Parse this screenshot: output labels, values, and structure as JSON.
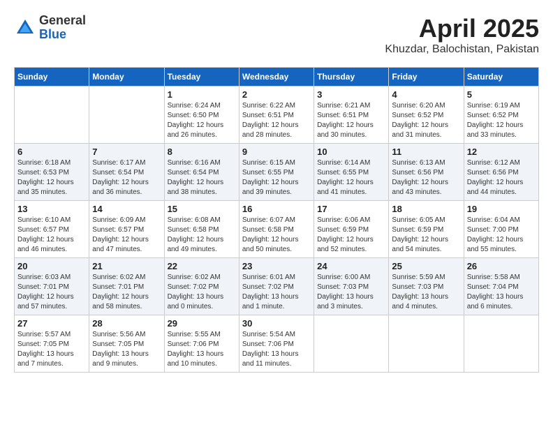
{
  "logo": {
    "general": "General",
    "blue": "Blue"
  },
  "title": "April 2025",
  "location": "Khuzdar, Balochistan, Pakistan",
  "days_of_week": [
    "Sunday",
    "Monday",
    "Tuesday",
    "Wednesday",
    "Thursday",
    "Friday",
    "Saturday"
  ],
  "weeks": [
    [
      {
        "day": "",
        "sunrise": "",
        "sunset": "",
        "daylight": ""
      },
      {
        "day": "",
        "sunrise": "",
        "sunset": "",
        "daylight": ""
      },
      {
        "day": "1",
        "sunrise": "Sunrise: 6:24 AM",
        "sunset": "Sunset: 6:50 PM",
        "daylight": "Daylight: 12 hours and 26 minutes."
      },
      {
        "day": "2",
        "sunrise": "Sunrise: 6:22 AM",
        "sunset": "Sunset: 6:51 PM",
        "daylight": "Daylight: 12 hours and 28 minutes."
      },
      {
        "day": "3",
        "sunrise": "Sunrise: 6:21 AM",
        "sunset": "Sunset: 6:51 PM",
        "daylight": "Daylight: 12 hours and 30 minutes."
      },
      {
        "day": "4",
        "sunrise": "Sunrise: 6:20 AM",
        "sunset": "Sunset: 6:52 PM",
        "daylight": "Daylight: 12 hours and 31 minutes."
      },
      {
        "day": "5",
        "sunrise": "Sunrise: 6:19 AM",
        "sunset": "Sunset: 6:52 PM",
        "daylight": "Daylight: 12 hours and 33 minutes."
      }
    ],
    [
      {
        "day": "6",
        "sunrise": "Sunrise: 6:18 AM",
        "sunset": "Sunset: 6:53 PM",
        "daylight": "Daylight: 12 hours and 35 minutes."
      },
      {
        "day": "7",
        "sunrise": "Sunrise: 6:17 AM",
        "sunset": "Sunset: 6:54 PM",
        "daylight": "Daylight: 12 hours and 36 minutes."
      },
      {
        "day": "8",
        "sunrise": "Sunrise: 6:16 AM",
        "sunset": "Sunset: 6:54 PM",
        "daylight": "Daylight: 12 hours and 38 minutes."
      },
      {
        "day": "9",
        "sunrise": "Sunrise: 6:15 AM",
        "sunset": "Sunset: 6:55 PM",
        "daylight": "Daylight: 12 hours and 39 minutes."
      },
      {
        "day": "10",
        "sunrise": "Sunrise: 6:14 AM",
        "sunset": "Sunset: 6:55 PM",
        "daylight": "Daylight: 12 hours and 41 minutes."
      },
      {
        "day": "11",
        "sunrise": "Sunrise: 6:13 AM",
        "sunset": "Sunset: 6:56 PM",
        "daylight": "Daylight: 12 hours and 43 minutes."
      },
      {
        "day": "12",
        "sunrise": "Sunrise: 6:12 AM",
        "sunset": "Sunset: 6:56 PM",
        "daylight": "Daylight: 12 hours and 44 minutes."
      }
    ],
    [
      {
        "day": "13",
        "sunrise": "Sunrise: 6:10 AM",
        "sunset": "Sunset: 6:57 PM",
        "daylight": "Daylight: 12 hours and 46 minutes."
      },
      {
        "day": "14",
        "sunrise": "Sunrise: 6:09 AM",
        "sunset": "Sunset: 6:57 PM",
        "daylight": "Daylight: 12 hours and 47 minutes."
      },
      {
        "day": "15",
        "sunrise": "Sunrise: 6:08 AM",
        "sunset": "Sunset: 6:58 PM",
        "daylight": "Daylight: 12 hours and 49 minutes."
      },
      {
        "day": "16",
        "sunrise": "Sunrise: 6:07 AM",
        "sunset": "Sunset: 6:58 PM",
        "daylight": "Daylight: 12 hours and 50 minutes."
      },
      {
        "day": "17",
        "sunrise": "Sunrise: 6:06 AM",
        "sunset": "Sunset: 6:59 PM",
        "daylight": "Daylight: 12 hours and 52 minutes."
      },
      {
        "day": "18",
        "sunrise": "Sunrise: 6:05 AM",
        "sunset": "Sunset: 6:59 PM",
        "daylight": "Daylight: 12 hours and 54 minutes."
      },
      {
        "day": "19",
        "sunrise": "Sunrise: 6:04 AM",
        "sunset": "Sunset: 7:00 PM",
        "daylight": "Daylight: 12 hours and 55 minutes."
      }
    ],
    [
      {
        "day": "20",
        "sunrise": "Sunrise: 6:03 AM",
        "sunset": "Sunset: 7:01 PM",
        "daylight": "Daylight: 12 hours and 57 minutes."
      },
      {
        "day": "21",
        "sunrise": "Sunrise: 6:02 AM",
        "sunset": "Sunset: 7:01 PM",
        "daylight": "Daylight: 12 hours and 58 minutes."
      },
      {
        "day": "22",
        "sunrise": "Sunrise: 6:02 AM",
        "sunset": "Sunset: 7:02 PM",
        "daylight": "Daylight: 13 hours and 0 minutes."
      },
      {
        "day": "23",
        "sunrise": "Sunrise: 6:01 AM",
        "sunset": "Sunset: 7:02 PM",
        "daylight": "Daylight: 13 hours and 1 minute."
      },
      {
        "day": "24",
        "sunrise": "Sunrise: 6:00 AM",
        "sunset": "Sunset: 7:03 PM",
        "daylight": "Daylight: 13 hours and 3 minutes."
      },
      {
        "day": "25",
        "sunrise": "Sunrise: 5:59 AM",
        "sunset": "Sunset: 7:03 PM",
        "daylight": "Daylight: 13 hours and 4 minutes."
      },
      {
        "day": "26",
        "sunrise": "Sunrise: 5:58 AM",
        "sunset": "Sunset: 7:04 PM",
        "daylight": "Daylight: 13 hours and 6 minutes."
      }
    ],
    [
      {
        "day": "27",
        "sunrise": "Sunrise: 5:57 AM",
        "sunset": "Sunset: 7:05 PM",
        "daylight": "Daylight: 13 hours and 7 minutes."
      },
      {
        "day": "28",
        "sunrise": "Sunrise: 5:56 AM",
        "sunset": "Sunset: 7:05 PM",
        "daylight": "Daylight: 13 hours and 9 minutes."
      },
      {
        "day": "29",
        "sunrise": "Sunrise: 5:55 AM",
        "sunset": "Sunset: 7:06 PM",
        "daylight": "Daylight: 13 hours and 10 minutes."
      },
      {
        "day": "30",
        "sunrise": "Sunrise: 5:54 AM",
        "sunset": "Sunset: 7:06 PM",
        "daylight": "Daylight: 13 hours and 11 minutes."
      },
      {
        "day": "",
        "sunrise": "",
        "sunset": "",
        "daylight": ""
      },
      {
        "day": "",
        "sunrise": "",
        "sunset": "",
        "daylight": ""
      },
      {
        "day": "",
        "sunrise": "",
        "sunset": "",
        "daylight": ""
      }
    ]
  ]
}
